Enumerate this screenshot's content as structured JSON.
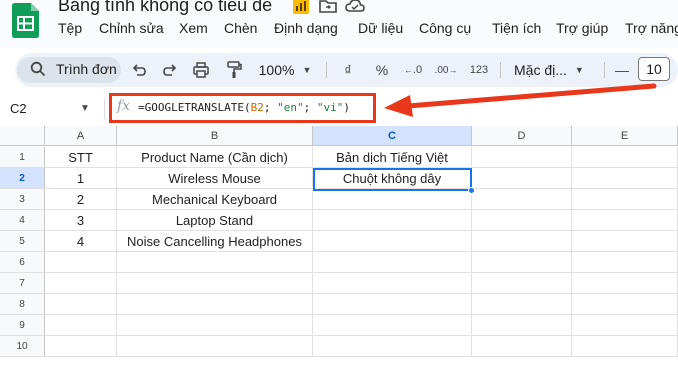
{
  "app": {
    "doc_title": "Bảng tính không có tiêu đề",
    "menu": [
      "Tệp",
      "Chỉnh sửa",
      "Xem",
      "Chèn",
      "Định dạng",
      "Dữ liệu",
      "Công cụ",
      "Tiện ích",
      "Trợ giúp",
      "Trợ năng"
    ]
  },
  "toolbar": {
    "search_label": "Trình đơn",
    "zoom": "100%",
    "currency": "₫",
    "percent": "%",
    "decimal_decrease": ".0",
    "decimal_increase": ".00",
    "number_format": "123",
    "font": "Mặc đị...",
    "font_minus": "—",
    "font_size": "10"
  },
  "formula_bar": {
    "name_box": "C2",
    "fx_label": "fx",
    "formula_parts": [
      "=GOOGLETRANSLATE(",
      "B2",
      "; ",
      "\"en\"",
      "; ",
      "\"vi\"",
      ")"
    ]
  },
  "grid": {
    "columns": [
      "A",
      "B",
      "C",
      "D",
      "E"
    ],
    "rows": [
      "1",
      "2",
      "3",
      "4",
      "5",
      "6",
      "7",
      "8",
      "9",
      "10"
    ],
    "cells": [
      [
        "STT",
        "Product Name (Cần dịch)",
        "Bản dịch Tiếng Việt",
        "",
        ""
      ],
      [
        "1",
        "Wireless Mouse",
        "Chuột không dây",
        "",
        ""
      ],
      [
        "2",
        "Mechanical Keyboard",
        "",
        "",
        ""
      ],
      [
        "3",
        "Laptop Stand",
        "",
        "",
        ""
      ],
      [
        "4",
        "Noise Cancelling Headphones",
        "",
        "",
        ""
      ]
    ]
  },
  "colors": {
    "accent": "#1a73e8",
    "annotation": "#e8371a",
    "selected_header": "#d3e3fd",
    "sheets_green": "#0f9d58"
  }
}
